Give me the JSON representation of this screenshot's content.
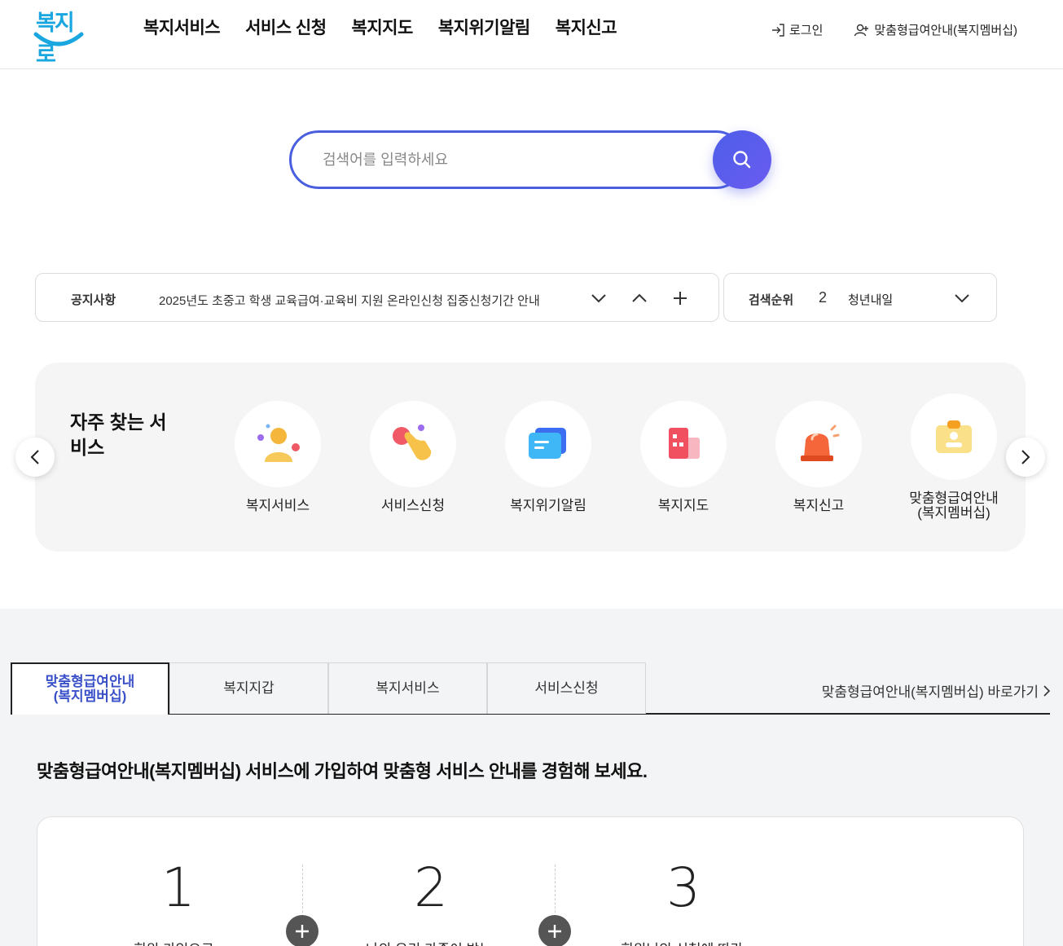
{
  "header": {
    "logo_text": "복지로",
    "nav": [
      "복지서비스",
      "서비스 신청",
      "복지지도",
      "복지위기알림",
      "복지신고"
    ],
    "login_label": "로그인",
    "membership_label": "맞춤형급여안내(복지멤버십)"
  },
  "search": {
    "placeholder": "검색어를 입력하세요"
  },
  "notice": {
    "label": "공지사항",
    "text": "2025년도 초중고 학생 교육급여·교육비 지원 온라인신청 집중신청기간 안내"
  },
  "rank": {
    "label": "검색순위",
    "number": "2",
    "keyword": "청년내일"
  },
  "quick": {
    "title": "자주 찾는 서비스",
    "items": [
      {
        "label": "복지서비스",
        "icon": "person-icon"
      },
      {
        "label": "서비스신청",
        "icon": "hand-tap-icon"
      },
      {
        "label": "복지위기알림",
        "icon": "message-icon"
      },
      {
        "label": "복지지도",
        "icon": "map-building-icon"
      },
      {
        "label": "복지신고",
        "icon": "siren-icon"
      },
      {
        "label": "맞춤형급여안내\n(복지멤버십)",
        "icon": "id-badge-icon"
      }
    ]
  },
  "tabs": {
    "items": [
      "맞춤형급여안내\n(복지멤버십)",
      "복지지갑",
      "복지서비스",
      "서비스신청"
    ],
    "active_index": 0,
    "shortcut_label": "맞춤형급여안내(복지멤버십) 바로가기"
  },
  "lead_text": "맞춤형급여안내(복지멤버십) 서비스에 가입하여 맞춤형 서비스 안내를 경험해 보세요.",
  "steps": {
    "numbers": [
      "1",
      "2",
      "3"
    ],
    "descriptions": [
      "회원 가입으로",
      "나의 우리 가족이 받는",
      "회원님의 신청에 따라"
    ]
  },
  "colors": {
    "accent": "#4a5fe0",
    "active_tab": "#3a50c8",
    "logo": "#1aa7e0"
  }
}
